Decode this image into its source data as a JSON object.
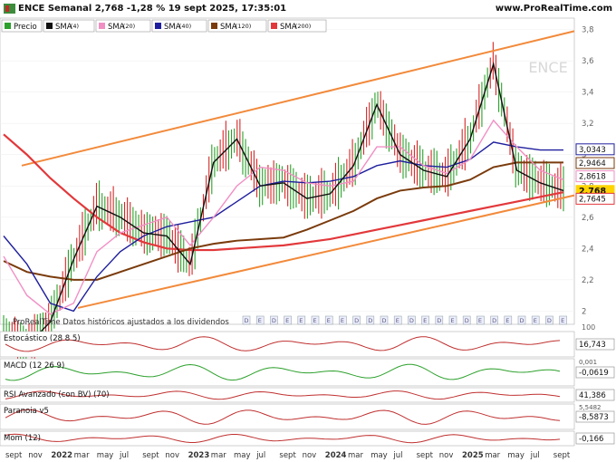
{
  "header": {
    "title": "ENCE Semanal 2,768 -1,28 % 19 sept 2025, 17:35:01",
    "site": "www.ProRealTime.com"
  },
  "legend": [
    {
      "label": "Precio",
      "param": "",
      "color": "#2ca02c"
    },
    {
      "label": "SMA",
      "param": "(4)",
      "color": "#111111"
    },
    {
      "label": "SMA",
      "param": "(20)",
      "color": "#f18fc4"
    },
    {
      "label": "SMA",
      "param": "(40)",
      "color": "#1f1f9e"
    },
    {
      "label": "SMA",
      "param": "(120)",
      "color": "#7a3b0c"
    },
    {
      "label": "SMA",
      "param": "(200)",
      "color": "#e2383b"
    }
  ],
  "watermark": "ENCE",
  "footnote": "ProRealTime  Datos históricos ajustados a los dividendos",
  "colors": {
    "up": "#2ca02c",
    "down": "#d62728",
    "channel": "#f28a3b",
    "sma200": "#e2383b",
    "sma120": "#7a3b0c",
    "sma40": "#1f1f9e",
    "sma20": "#f18fc4",
    "sma4": "#111111",
    "last_badge": "#ffd400"
  },
  "chart_data": {
    "type": "line",
    "title": "ENCE Semanal",
    "x": [
      "sept",
      "nov",
      "2022",
      "mar",
      "may",
      "jul",
      "sept",
      "nov",
      "2023",
      "mar",
      "may",
      "jul",
      "sept",
      "nov",
      "2024",
      "mar",
      "may",
      "jul",
      "sept",
      "nov",
      "2025",
      "mar",
      "may",
      "jul",
      "sept"
    ],
    "ylim": [
      1.95,
      3.85
    ],
    "yticks": [
      "3,8",
      "3,6",
      "3,4",
      "3,2",
      "3",
      "2,8",
      "2,6",
      "2,4",
      "2,2",
      "2"
    ],
    "series": [
      {
        "name": "SMA",
        "period": "(4)",
        "color": "#111111",
        "values": [
          1.85,
          1.78,
          1.93,
          2.33,
          2.67,
          2.6,
          2.5,
          2.48,
          2.3,
          2.95,
          3.1,
          2.8,
          2.82,
          2.72,
          2.75,
          2.93,
          3.32,
          3.0,
          2.9,
          2.86,
          3.1,
          3.58,
          2.9,
          2.82,
          2.77
        ]
      },
      {
        "name": "SMA",
        "period": "(20)",
        "color": "#f18fc4",
        "values": [
          2.35,
          2.1,
          1.98,
          2.05,
          2.38,
          2.5,
          2.55,
          2.6,
          2.42,
          2.6,
          2.8,
          2.92,
          2.9,
          2.82,
          2.8,
          2.83,
          3.05,
          3.05,
          2.93,
          2.88,
          2.97,
          3.22,
          3.05,
          2.9,
          2.84
        ]
      },
      {
        "name": "SMA",
        "period": "(40)",
        "color": "#1f1f9e",
        "values": [
          2.48,
          2.3,
          2.05,
          2.0,
          2.22,
          2.38,
          2.48,
          2.54,
          2.57,
          2.6,
          2.7,
          2.8,
          2.83,
          2.82,
          2.83,
          2.86,
          2.93,
          2.96,
          2.93,
          2.92,
          2.97,
          3.08,
          3.05,
          3.03,
          3.03
        ]
      },
      {
        "name": "SMA",
        "period": "(120)",
        "color": "#7a3b0c",
        "values": [
          2.32,
          2.25,
          2.22,
          2.2,
          2.2,
          2.25,
          2.3,
          2.35,
          2.4,
          2.43,
          2.45,
          2.46,
          2.47,
          2.52,
          2.58,
          2.64,
          2.72,
          2.77,
          2.79,
          2.8,
          2.84,
          2.92,
          2.95,
          2.95,
          2.95
        ]
      },
      {
        "name": "SMA",
        "period": "(200)",
        "color": "#e2383b",
        "values": [
          3.13,
          3.0,
          2.85,
          2.72,
          2.6,
          2.5,
          2.44,
          2.4,
          2.39,
          2.39,
          2.4,
          2.41,
          2.42,
          2.44,
          2.46,
          2.49,
          2.52,
          2.55,
          2.58,
          2.61,
          2.64,
          2.67,
          2.7,
          2.73,
          2.76
        ]
      }
    ],
    "price_labels": [
      {
        "value": "3,0343",
        "color": "#1f1f9e"
      },
      {
        "value": "2,9464",
        "color": "#7a3b0c"
      },
      {
        "value": "2,8618",
        "color": "#f18fc4"
      },
      {
        "value": "2,768",
        "color": "#ffd400"
      },
      {
        "value": "2,7645",
        "color": "#e2383b"
      }
    ],
    "channel": {
      "upper": [
        2.93,
        3.79
      ],
      "lower": [
        2.02,
        2.74
      ],
      "color": "#f28a3b"
    }
  },
  "markers": [
    "D",
    "E",
    "D",
    "E",
    "E",
    "E",
    "E",
    "E",
    "D",
    "D",
    "D",
    "E",
    "D",
    "E",
    "D",
    "E",
    "D",
    "E",
    "D",
    "E",
    "D",
    "E",
    "D",
    "E"
  ],
  "indicators": [
    {
      "name": "Estocástico",
      "param": "(28 8 5)",
      "value": "16,743",
      "scale": "100"
    },
    {
      "name": "MACD",
      "param": "(12 26 9)",
      "value": "-0,0619",
      "extra": "0,001"
    },
    {
      "name": "RSI Avanzado (con BV)",
      "param": "(70)",
      "value": "41,386"
    },
    {
      "name": "Paranoia v5",
      "param": "",
      "value": "-8,5873",
      "extra": "5,5482"
    },
    {
      "name": "Mom",
      "param": "(12)",
      "value": "-0,166"
    }
  ]
}
